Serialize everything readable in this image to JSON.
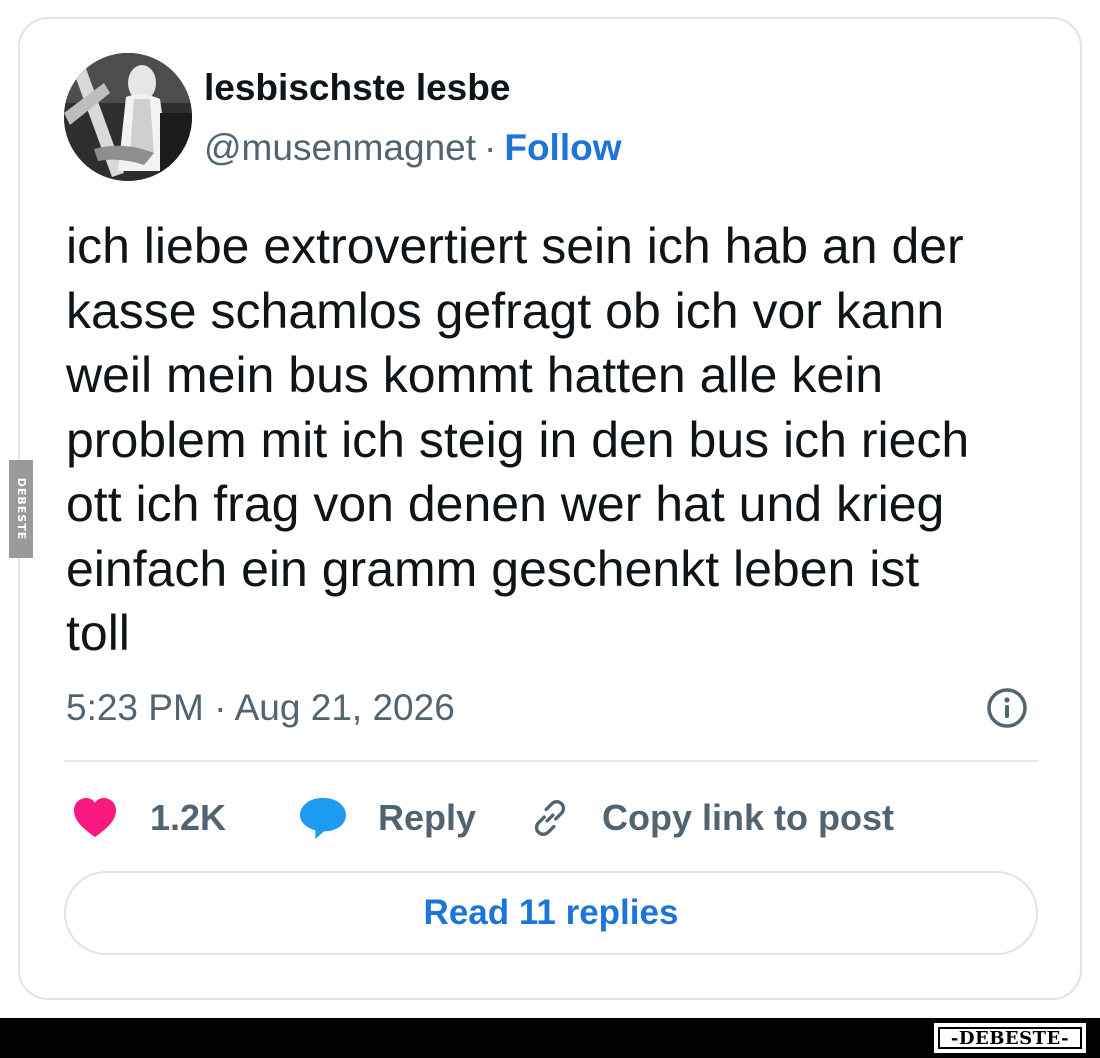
{
  "user": {
    "display_name": "lesbischste lesbe",
    "handle": "@musenmagnet",
    "separator": "·",
    "follow_label": "Follow"
  },
  "tweet": {
    "lines": [
      "ich liebe extrovertiert sein ich hab an der",
      "kasse schamlos gefragt ob ich vor kann",
      "weil mein bus kommt hatten alle kein",
      "problem mit ich steig in den bus ich riech",
      "ott ich frag von denen wer hat und krieg",
      "einfach ein gramm geschenkt leben ist",
      "toll"
    ],
    "timestamp": "5:23 PM · Aug 21, 2026"
  },
  "actions": {
    "like_count": "1.2K",
    "reply_label": "Reply",
    "copy_label": "Copy link to post",
    "read_replies_label": "Read 11 replies"
  },
  "watermark": {
    "side_text": "DEBESTE",
    "bottom_text": "-DEBESTE-"
  },
  "colors": {
    "link_blue": "#1d75d8",
    "heart_pink": "#f91880",
    "bubble_blue": "#1d9bf0",
    "muted_text": "#536471",
    "border": "#dfe4e8"
  },
  "icons": [
    "info-icon",
    "heart-icon",
    "reply-bubble-icon",
    "link-icon"
  ]
}
